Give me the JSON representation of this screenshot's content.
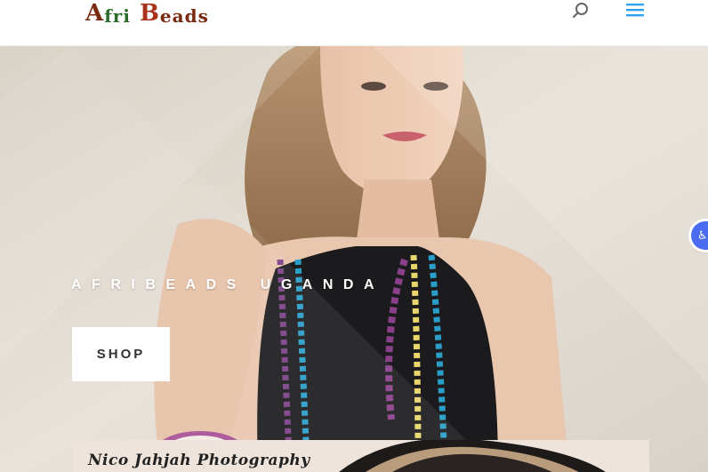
{
  "header": {
    "logo_part1": "A",
    "logo_part2": "fri",
    "logo_part3": "B",
    "logo_part4": "eads",
    "search_icon": "search-icon",
    "menu_icon": "hamburger-menu-icon"
  },
  "hero": {
    "title": "AFRIBEADS UGANDA",
    "shop_label": "SHOP",
    "accessibility_icon": "accessibility-icon",
    "accessibility_glyph": "♿",
    "photo_credit": "Nico Jahjah Photography"
  },
  "colors": {
    "accent": "#2ea3f2",
    "header_bg": "#ffffff",
    "hero_text": "#ffffff",
    "button_bg": "#ffffff",
    "button_text": "#333333",
    "a11y_bg": "#4b6cf0"
  }
}
